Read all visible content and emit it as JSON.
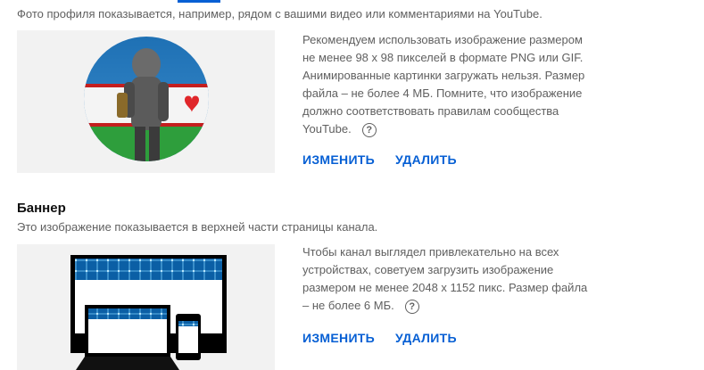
{
  "profile": {
    "intro": "Фото профиля показывается, например, рядом с вашими видео или комментариями на YouTube.",
    "description": "Рекомендуем использовать изображение размером не менее 98 x 98 пикселей в формате PNG или GIF. Анимированные картинки загружать нельзя. Размер файла – не более 4 МБ. Помните, что изображение должно соответствовать правилам сообщества YouTube.",
    "change_label": "ИЗМЕНИТЬ",
    "delete_label": "УДАЛИТЬ",
    "help_icon": "?"
  },
  "banner": {
    "title": "Баннер",
    "subtitle": "Это изображение показывается в верхней части страницы канала.",
    "description": "Чтобы канал выглядел привлекательно на всех устройствах, советуем загрузить изображение размером не менее 2048 x 1152 пикс. Размер файла – не более 6 МБ.",
    "change_label": "ИЗМЕНИТЬ",
    "delete_label": "УДАЛИТЬ",
    "help_icon": "?"
  },
  "colors": {
    "accent": "#065fd4",
    "secondary_text": "#606060",
    "panel_bg": "#f2f2f2"
  }
}
